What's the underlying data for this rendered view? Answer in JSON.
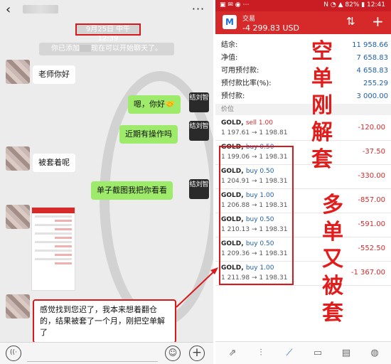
{
  "chat": {
    "back_glyph": "‹",
    "more_glyph": "···",
    "timestamp": "9月25日 中午12:39",
    "system_message_before": "你已添加",
    "system_message_after": "现在可以开始聊天了。",
    "messages": [
      {
        "dir": "in",
        "text": "老师你好"
      },
      {
        "dir": "out",
        "text": "嗯，你好🤝"
      },
      {
        "dir": "out",
        "text": "近期有操作吗"
      },
      {
        "dir": "in",
        "text": "被套着呢"
      },
      {
        "dir": "out",
        "text": "单子截图我把你看看"
      },
      {
        "dir": "in",
        "text": "感觉找到您迟了，我本来想着翻仓的，结果被套了一个月，刚把空单解了"
      }
    ],
    "logo_text": "结刘智",
    "input": {
      "voice_glyph": "((·",
      "emoji_glyph": "☺",
      "plus_glyph": "+"
    }
  },
  "trade": {
    "status_left": "▣ ✉ ◉ ⋯",
    "status_right": "N ◔ ▲ 82% ▮ 12:41",
    "app_icon_glyph": "M",
    "title": "交易",
    "profit": "-4 299.83 USD",
    "sort_glyph": "⇅",
    "add_glyph": "+",
    "summary": [
      {
        "label": "结余:",
        "value": "11 958.66"
      },
      {
        "label": "净值:",
        "value": "7 658.83"
      },
      {
        "label": "可用预付款:",
        "value": "4 658.83"
      },
      {
        "label": "预付款比率(%):",
        "value": "255.29"
      },
      {
        "label": "预付款:",
        "value": "3 000.00"
      }
    ],
    "section_label": "价位",
    "orders": [
      {
        "symbol": "GOLD,",
        "side": "sell",
        "lot": "sell 1.00",
        "open": "1 197.61",
        "current": "1 198.81",
        "pnl": "-120.00"
      },
      {
        "symbol": "GOLD,",
        "side": "buy",
        "lot": "buy 0.50",
        "open": "1 199.06",
        "current": "1 198.31",
        "pnl": "-37.50"
      },
      {
        "symbol": "GOLD,",
        "side": "buy",
        "lot": "buy 0.50",
        "open": "1 204.91",
        "current": "1 198.31",
        "pnl": "-330.00"
      },
      {
        "symbol": "GOLD,",
        "side": "buy",
        "lot": "buy 1.00",
        "open": "1 206.88",
        "current": "1 198.31",
        "pnl": "-857.00"
      },
      {
        "symbol": "GOLD,",
        "side": "buy",
        "lot": "buy 0.50",
        "open": "1 210.13",
        "current": "1 198.31",
        "pnl": "-591.00"
      },
      {
        "symbol": "GOLD,",
        "side": "buy",
        "lot": "buy 0.50",
        "open": "1 209.36",
        "current": "1 198.31",
        "pnl": "-552.50"
      },
      {
        "symbol": "GOLD,",
        "side": "buy",
        "lot": "buy 1.00",
        "open": "1 211.98",
        "current": "1 198.31",
        "pnl": "-1 367.00"
      }
    ],
    "arrow_glyph": "→",
    "annotation_1": "空单刚解套",
    "annotation_2": "多单又被套",
    "nav": [
      {
        "name": "quotes-icon",
        "glyph": "⇗"
      },
      {
        "name": "candles-icon",
        "glyph": "⫶"
      },
      {
        "name": "trade-icon",
        "glyph": "⟋"
      },
      {
        "name": "history-icon",
        "glyph": "▭"
      },
      {
        "name": "news-icon",
        "glyph": "▤"
      },
      {
        "name": "chat-icon",
        "glyph": "◍"
      }
    ]
  }
}
